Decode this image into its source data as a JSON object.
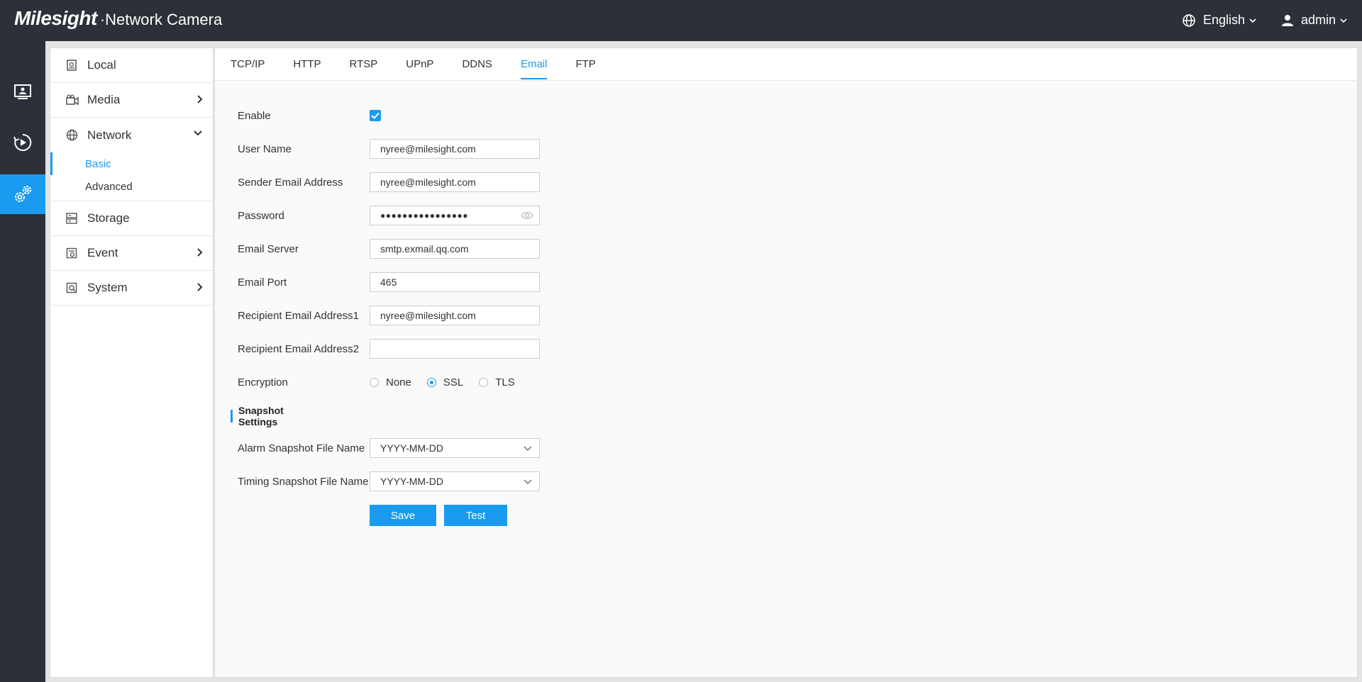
{
  "header": {
    "brand_logo": "Milesight",
    "brand_product": "·Network Camera",
    "language": "English",
    "user": "admin"
  },
  "rail": {
    "items": [
      {
        "icon": "live-view-icon",
        "active": false
      },
      {
        "icon": "playback-icon",
        "active": false
      },
      {
        "icon": "settings-icon",
        "active": true
      }
    ]
  },
  "sidebar": {
    "items": [
      {
        "label": "Local",
        "icon": "local-icon"
      },
      {
        "label": "Media",
        "icon": "media-icon"
      },
      {
        "label": "Network",
        "icon": "globe-icon",
        "expanded": true,
        "children": [
          "Basic",
          "Advanced"
        ],
        "active_child": "Basic"
      },
      {
        "label": "Storage",
        "icon": "storage-icon"
      },
      {
        "label": "Event",
        "icon": "event-icon"
      },
      {
        "label": "System",
        "icon": "system-icon"
      }
    ]
  },
  "tabs": [
    "TCP/IP",
    "HTTP",
    "RTSP",
    "UPnP",
    "DDNS",
    "Email",
    "FTP"
  ],
  "active_tab": "Email",
  "form": {
    "enable_label": "Enable",
    "enable_checked": true,
    "user_name_label": "User Name",
    "user_name_value": "nyree@milesight.com",
    "sender_label": "Sender Email Address",
    "sender_value": "nyree@milesight.com",
    "password_label": "Password",
    "password_value": "●●●●●●●●●●●●●●●●",
    "server_label": "Email Server",
    "server_value": "smtp.exmail.qq.com",
    "port_label": "Email Port",
    "port_value": "465",
    "recipient1_label": "Recipient Email Address1",
    "recipient1_value": "nyree@milesight.com",
    "recipient2_label": "Recipient Email Address2",
    "recipient2_value": "",
    "encryption_label": "Encryption",
    "encryption_options": [
      "None",
      "SSL",
      "TLS"
    ],
    "encryption_selected": "SSL",
    "snapshot_title": "Snapshot Settings",
    "alarm_snapshot_label": "Alarm Snapshot File Name",
    "alarm_snapshot_value": "YYYY-MM-DD",
    "timing_snapshot_label": "Timing Snapshot File Name",
    "timing_snapshot_value": "YYYY-MM-DD",
    "save_label": "Save",
    "test_label": "Test"
  },
  "colors": {
    "accent": "#1a9bf0",
    "header_bg": "#2c3038"
  }
}
